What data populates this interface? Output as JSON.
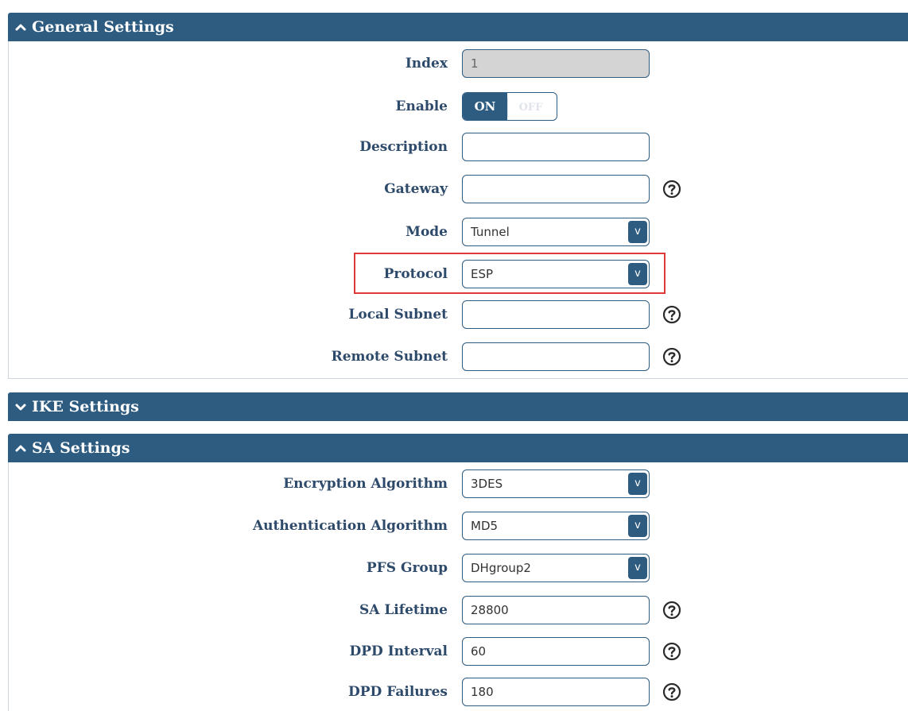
{
  "general": {
    "title": "General Settings",
    "index": {
      "label": "Index",
      "value": "1"
    },
    "enable": {
      "label": "Enable",
      "on": "ON",
      "off": "OFF"
    },
    "description": {
      "label": "Description",
      "value": ""
    },
    "gateway": {
      "label": "Gateway",
      "value": ""
    },
    "mode": {
      "label": "Mode",
      "value": "Tunnel",
      "arrow": "v"
    },
    "protocol": {
      "label": "Protocol",
      "value": "ESP",
      "arrow": "v"
    },
    "local_subnet": {
      "label": "Local Subnet",
      "value": ""
    },
    "remote_subnet": {
      "label": "Remote Subnet",
      "value": ""
    }
  },
  "ike": {
    "title": "IKE Settings"
  },
  "sa": {
    "title": "SA Settings",
    "encryption": {
      "label": "Encryption Algorithm",
      "value": "3DES",
      "arrow": "v"
    },
    "authentication": {
      "label": "Authentication Algorithm",
      "value": "MD5",
      "arrow": "v"
    },
    "pfs": {
      "label": "PFS Group",
      "value": "DHgroup2",
      "arrow": "v"
    },
    "lifetime": {
      "label": "SA Lifetime",
      "value": "28800"
    },
    "dpd_interval": {
      "label": "DPD Interval",
      "value": "60"
    },
    "dpd_failures": {
      "label": "DPD Failures",
      "value": "180"
    }
  },
  "icons": {
    "expanded": "chevron-up-icon",
    "collapsed": "chevron-down-icon",
    "help": "question-circle-icon"
  },
  "colors": {
    "header_bg": "#2e5b80",
    "label_text": "#2e4a6b",
    "highlight": "#e0393c",
    "readonly_bg": "#d4d4d4"
  }
}
